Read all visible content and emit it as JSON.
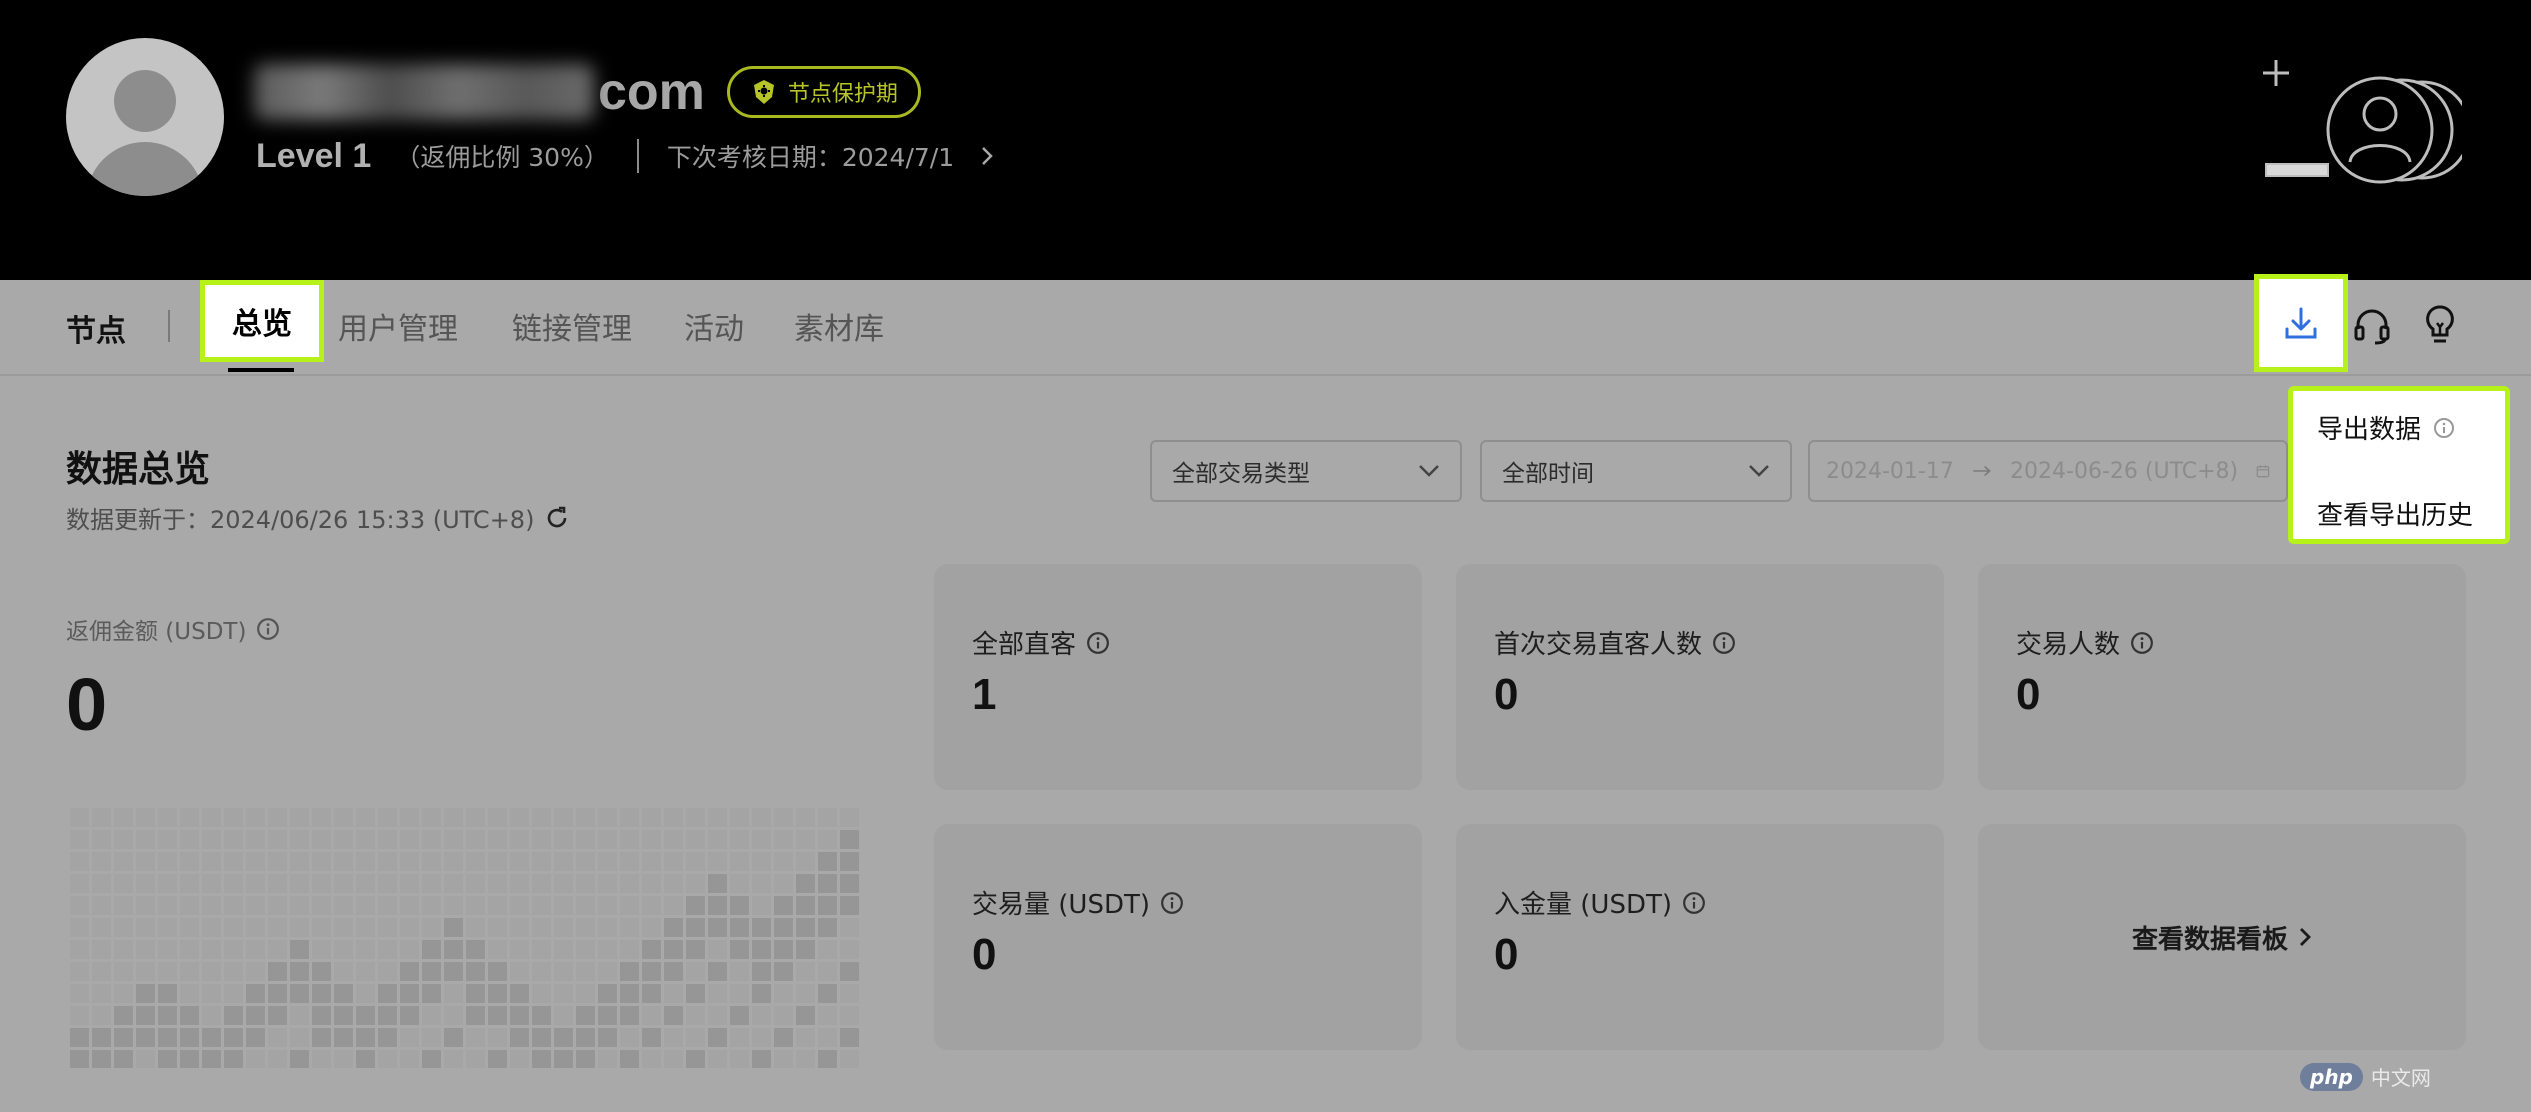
{
  "header": {
    "email_domain": "com",
    "badge_label": "节点保护期",
    "level": "Level 1",
    "rebate_ratio": "（返佣比例 30%）",
    "next_review": "下次考核日期：2024/7/1"
  },
  "nav": {
    "node_label": "节点",
    "tabs": [
      {
        "label": "总览"
      },
      {
        "label": "用户管理"
      },
      {
        "label": "链接管理"
      },
      {
        "label": "活动"
      },
      {
        "label": "素材库"
      }
    ]
  },
  "export_menu": {
    "items": [
      {
        "label": "导出数据"
      },
      {
        "label": "查看导出历史"
      }
    ]
  },
  "overview": {
    "title": "数据总览",
    "updated": "数据更新于：2024/06/26 15:33 (UTC+8)",
    "filters": {
      "trade_type": "全部交易类型",
      "time": "全部时间",
      "start_date": "2024-01-17",
      "end_date": "2024-06-26 (UTC+8)"
    },
    "rebate": {
      "label": "返佣金额 (USDT)",
      "value": "0"
    },
    "cards": [
      {
        "label": "全部直客",
        "value": "1"
      },
      {
        "label": "首次交易直客人数",
        "value": "0"
      },
      {
        "label": "交易人数",
        "value": "0"
      },
      {
        "label": "交易量 (USDT)",
        "value": "0"
      },
      {
        "label": "入金量 (USDT)",
        "value": "0"
      }
    ],
    "dashboard_link": "查看数据看板"
  },
  "watermark": {
    "brand": "php",
    "site": "中文网"
  },
  "colors": {
    "highlight": "#b6f21a",
    "accent_blue": "#2f6fe0",
    "badge_green": "#b6c428"
  }
}
